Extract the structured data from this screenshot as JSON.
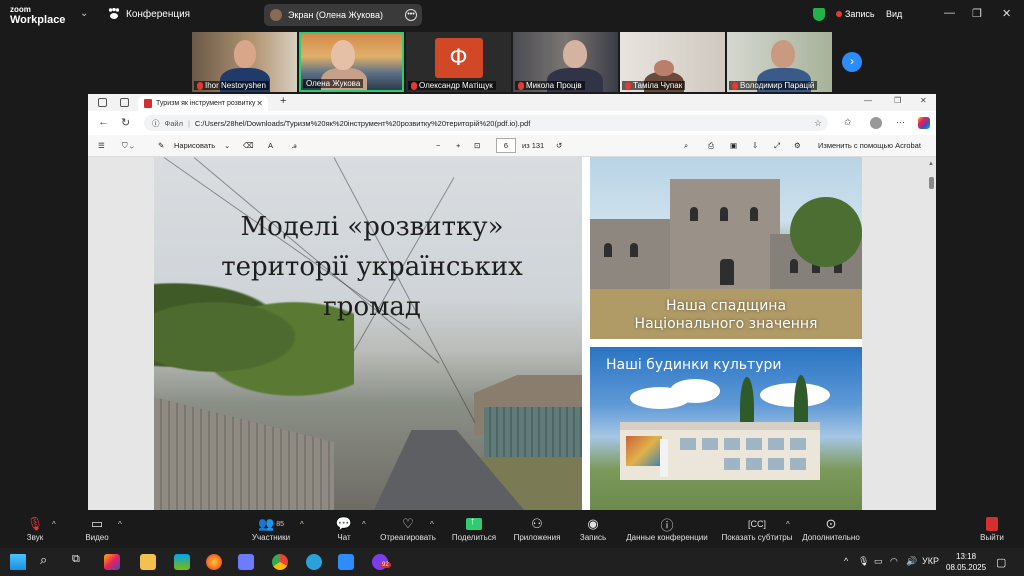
{
  "zoom": {
    "logo_line1": "zoom",
    "logo_line2": "Workplace",
    "meeting_label": "Конференция",
    "screen_share_label": "Экран (Олена Жукова)",
    "record_label": "Запись",
    "view_label": "Вид"
  },
  "participants": [
    {
      "name": "Ihor Nestoryshen"
    },
    {
      "name": "Олена Жукова"
    },
    {
      "name": "Олександр Матіщук",
      "avatar_letter": "Ф"
    },
    {
      "name": "Микола Проців"
    },
    {
      "name": "Тамiла Чупак"
    },
    {
      "name": "Володимир Парацій"
    }
  ],
  "browser": {
    "tab_title": "Туризм як інструмент розвитку",
    "url_prefix": "Файл",
    "url": "C:/Users/28hel/Downloads/Туризм%20як%20інструмент%20розвитку%20територій%20(pdf.io).pdf"
  },
  "pdf_toolbar": {
    "draw_label": "Нарисовать",
    "page_current": "6",
    "page_total": "из 131",
    "edit_acrobat": "Изменить с помощью Acrobat"
  },
  "slide": {
    "title_line1": "Моделі «розвитку»",
    "title_line2": "території українських",
    "title_line3": "громад",
    "caption_top_line1": "Наша спадщина",
    "caption_top_line2": "Національного значення",
    "caption_bottom": "Наші будинки культури"
  },
  "toolbar": {
    "sound": "Звук",
    "video": "Видео",
    "participants": "Участники",
    "participants_count": "85",
    "chat": "Чат",
    "react": "Отреагировать",
    "share": "Поделиться",
    "apps": "Приложения",
    "record": "Запись",
    "meeting_info": "Данные конференции",
    "captions": "Показать субтитры",
    "more": "Дополнительно",
    "leave": "Выйти"
  },
  "taskbar": {
    "lang": "УКР",
    "time": "13:18",
    "date": "08.05.2025",
    "badge_count": "92"
  },
  "colors": {
    "zoom_bg": "#1a1a1a",
    "active_border": "#2ecc71",
    "share_green": "#2ecc71",
    "accent_blue": "#2d8cff",
    "leave_red": "#d32f2f",
    "office_orange": "#d24726"
  }
}
